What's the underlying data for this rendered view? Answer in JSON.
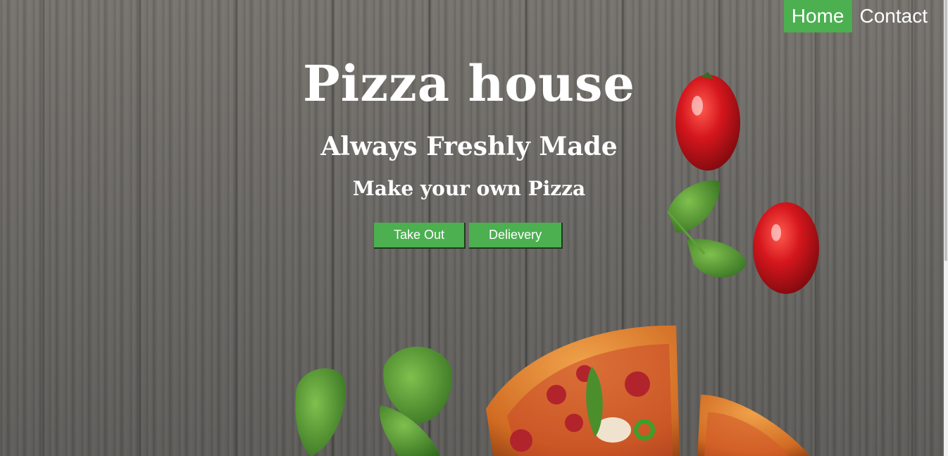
{
  "nav": {
    "items": [
      {
        "label": "Home",
        "active": true
      },
      {
        "label": "Contact",
        "active": false
      }
    ]
  },
  "hero": {
    "title": "Pizza house",
    "subtitle": "Always Freshly Made",
    "tagline": "Make your own Pizza",
    "buttons": [
      "Take Out",
      "Delievery"
    ]
  },
  "colors": {
    "accent": "#4caf50",
    "text": "#ffffff",
    "wood": "#6c6a67",
    "tomato": "#c8161d",
    "leaf": "#4e8f2e",
    "crust": "#d9782b"
  },
  "icons": [
    "tomato-image",
    "basil-leaf-image",
    "pizza-slice-image"
  ]
}
